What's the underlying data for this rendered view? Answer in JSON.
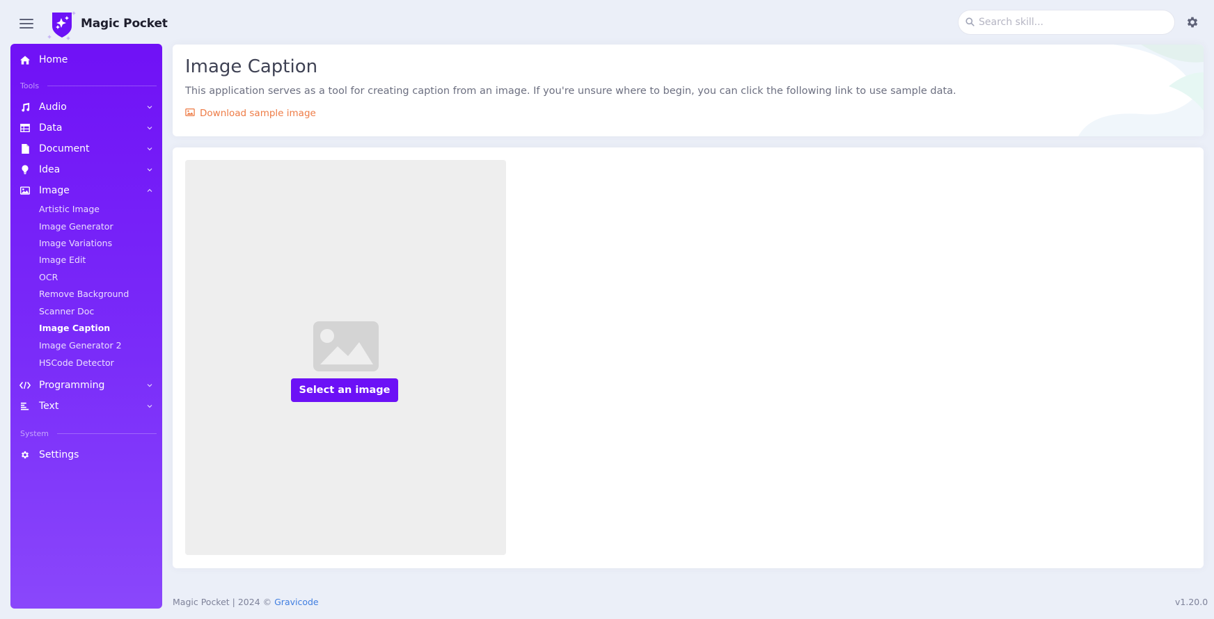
{
  "header": {
    "brand_name": "Magic Pocket",
    "search_placeholder": "Search skill..."
  },
  "sidebar": {
    "home": "Home",
    "section_tools": "Tools",
    "items": [
      {
        "label": "Audio",
        "icon": "music-icon"
      },
      {
        "label": "Data",
        "icon": "table-icon"
      },
      {
        "label": "Document",
        "icon": "document-icon"
      },
      {
        "label": "Idea",
        "icon": "lightbulb-icon"
      },
      {
        "label": "Image",
        "icon": "image-icon",
        "expanded": true
      }
    ],
    "image_subitems": [
      "Artistic Image",
      "Image Generator",
      "Image Variations",
      "Image Edit",
      "OCR",
      "Remove Background",
      "Scanner Doc",
      "Image Caption",
      "Image Generator 2",
      "HSCode Detector"
    ],
    "active_subitem": "Image Caption",
    "programming": "Programming",
    "text": "Text",
    "section_system": "System",
    "settings": "Settings"
  },
  "main": {
    "title": "Image Caption",
    "description": "This application serves as a tool for creating caption from an image. If you're unsure where to begin, you can click the following link to use sample data.",
    "sample_link": "Download sample image",
    "select_button": "Select an image"
  },
  "footer": {
    "copyright": "Magic Pocket | 2024 © ",
    "company": "Gravicode",
    "version": "v1.20.0"
  },
  "colors": {
    "accent": "#6c11f6",
    "link_orange": "#ee7b45",
    "footer_link": "#3f7de0",
    "background": "#ebeff8"
  }
}
